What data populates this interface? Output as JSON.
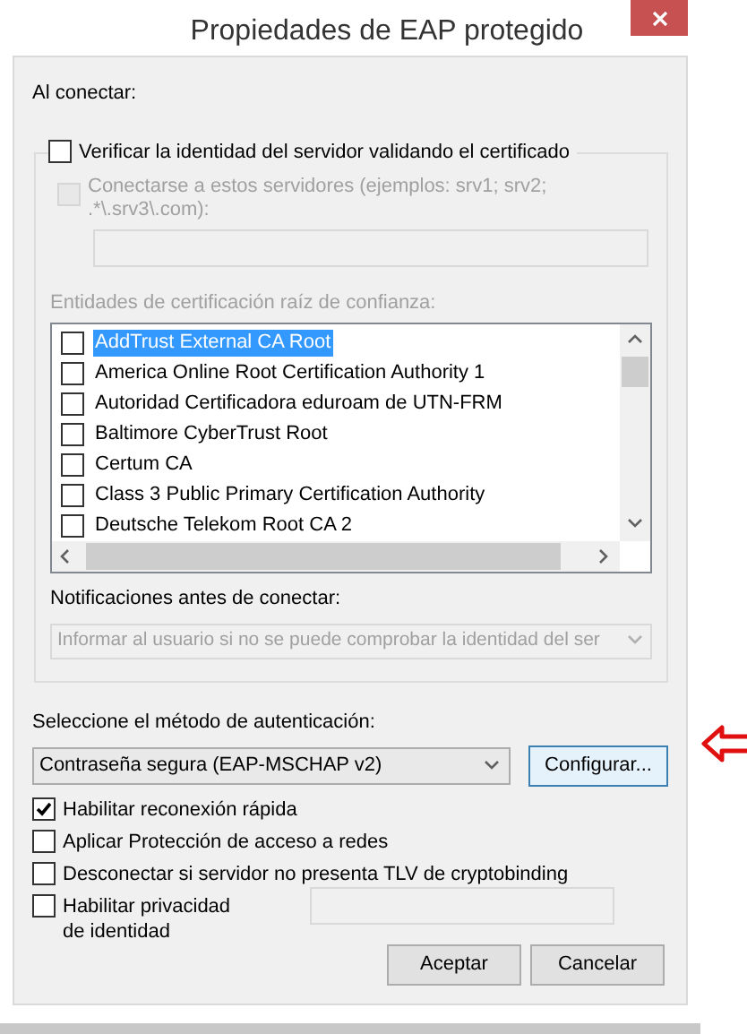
{
  "window": {
    "title": "Propiedades de EAP protegido"
  },
  "on_connect": {
    "label": "Al conectar:",
    "verify": {
      "label": "Verificar la identidad del servidor validando el certificado",
      "checked": false
    },
    "servers": {
      "label_lines": [
        "Conectarse a estos servidores (ejemplos: srv1; srv2;",
        ".*\\.srv3\\.com):"
      ],
      "checked": false,
      "disabled": true
    },
    "ca_label": "Entidades de certificación raíz de confianza:",
    "ca_list": [
      {
        "name": "AddTrust External CA Root",
        "checked": false,
        "selected": true
      },
      {
        "name": "America Online Root Certification Authority 1",
        "checked": false,
        "selected": false
      },
      {
        "name": "Autoridad Certificadora eduroam de UTN-FRM",
        "checked": false,
        "selected": false
      },
      {
        "name": "Baltimore CyberTrust Root",
        "checked": false,
        "selected": false
      },
      {
        "name": "Certum CA",
        "checked": false,
        "selected": false
      },
      {
        "name": "Class 3 Public Primary Certification Authority",
        "checked": false,
        "selected": false
      },
      {
        "name": "Deutsche Telekom Root CA 2",
        "checked": false,
        "selected": false
      }
    ],
    "notify_label": "Notificaciones antes de conectar:",
    "notify_value": "Informar al usuario si no se puede comprobar la identidad del ser"
  },
  "auth": {
    "label": "Seleccione el método de autenticación:",
    "value": "Contraseña segura (EAP-MSCHAP v2)",
    "configure": "Configurar..."
  },
  "options": [
    {
      "label_lines": [
        "Habilitar reconexión rápida"
      ],
      "checked": true,
      "has_field": false
    },
    {
      "label_lines": [
        "Aplicar Protección de acceso a redes"
      ],
      "checked": false,
      "has_field": false
    },
    {
      "label_lines": [
        "Desconectar si servidor no presenta TLV de cryptobinding"
      ],
      "checked": false,
      "has_field": false
    },
    {
      "label_lines": [
        "Habilitar privacidad",
        "de identidad"
      ],
      "checked": false,
      "has_field": true
    }
  ],
  "buttons": [
    "Aceptar",
    "Cancelar"
  ]
}
